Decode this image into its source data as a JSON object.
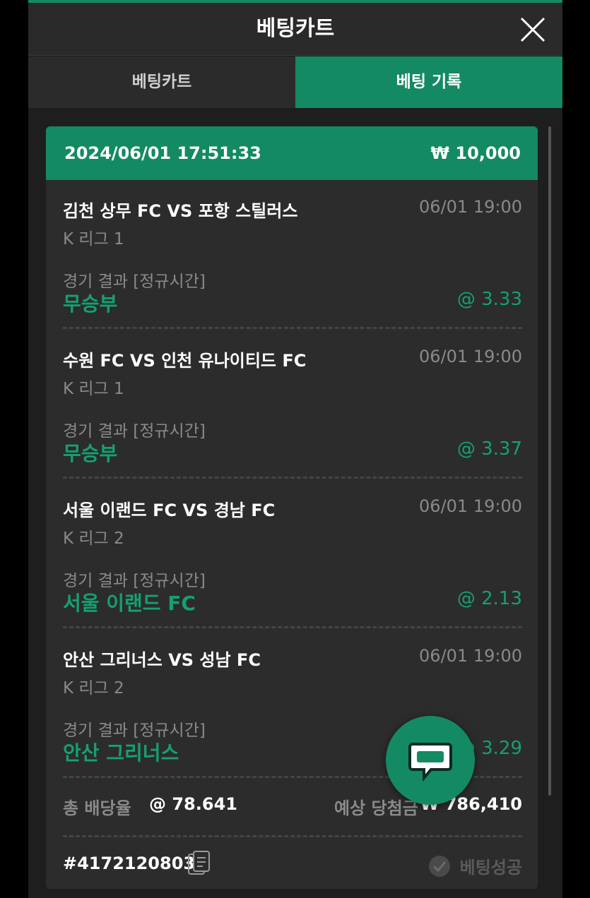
{
  "header": {
    "title": "베팅카트"
  },
  "tabs": [
    {
      "label": "베팅카트",
      "active": false
    },
    {
      "label": "베팅 기록",
      "active": true
    }
  ],
  "record": {
    "datetime": "2024/06/01 17:51:33",
    "stake": "₩ 10,000",
    "bets": [
      {
        "match": "김천 상무 FC VS 포항 스틸러스",
        "time": "06/01 19:00",
        "league": "K 리그 1",
        "market": "경기 결과 [정규시간]",
        "pick": "무승부",
        "odds": "@ 3.33"
      },
      {
        "match": "수원 FC VS 인천 유나이티드 FC",
        "time": "06/01 19:00",
        "league": "K 리그 1",
        "market": "경기 결과 [정규시간]",
        "pick": "무승부",
        "odds": "@ 3.37"
      },
      {
        "match": "서울 이랜드 FC VS 경남 FC",
        "time": "06/01 19:00",
        "league": "K 리그 2",
        "market": "경기 결과 [정규시간]",
        "pick": "서울 이랜드 FC",
        "odds": "@ 2.13"
      },
      {
        "match": "안산 그리너스 VS 성남 FC",
        "time": "06/01 19:00",
        "league": "K 리그 2",
        "market": "경기 결과 [정규시간]",
        "pick": "안산 그리너스",
        "odds": "@ 3.29"
      }
    ],
    "total_odds_label": "총 배당율",
    "total_odds": "@ 78.641",
    "payout_label": "예상 당첨금",
    "payout": "₩ 786,410",
    "bet_id": "#4172120803",
    "status": "베팅성공"
  },
  "colors": {
    "accent": "#138a63",
    "pick": "#15a070"
  },
  "icons": {
    "close": "close-icon",
    "copy": "copy-icon",
    "status": "check-circle-icon",
    "chat": "chat-icon"
  }
}
